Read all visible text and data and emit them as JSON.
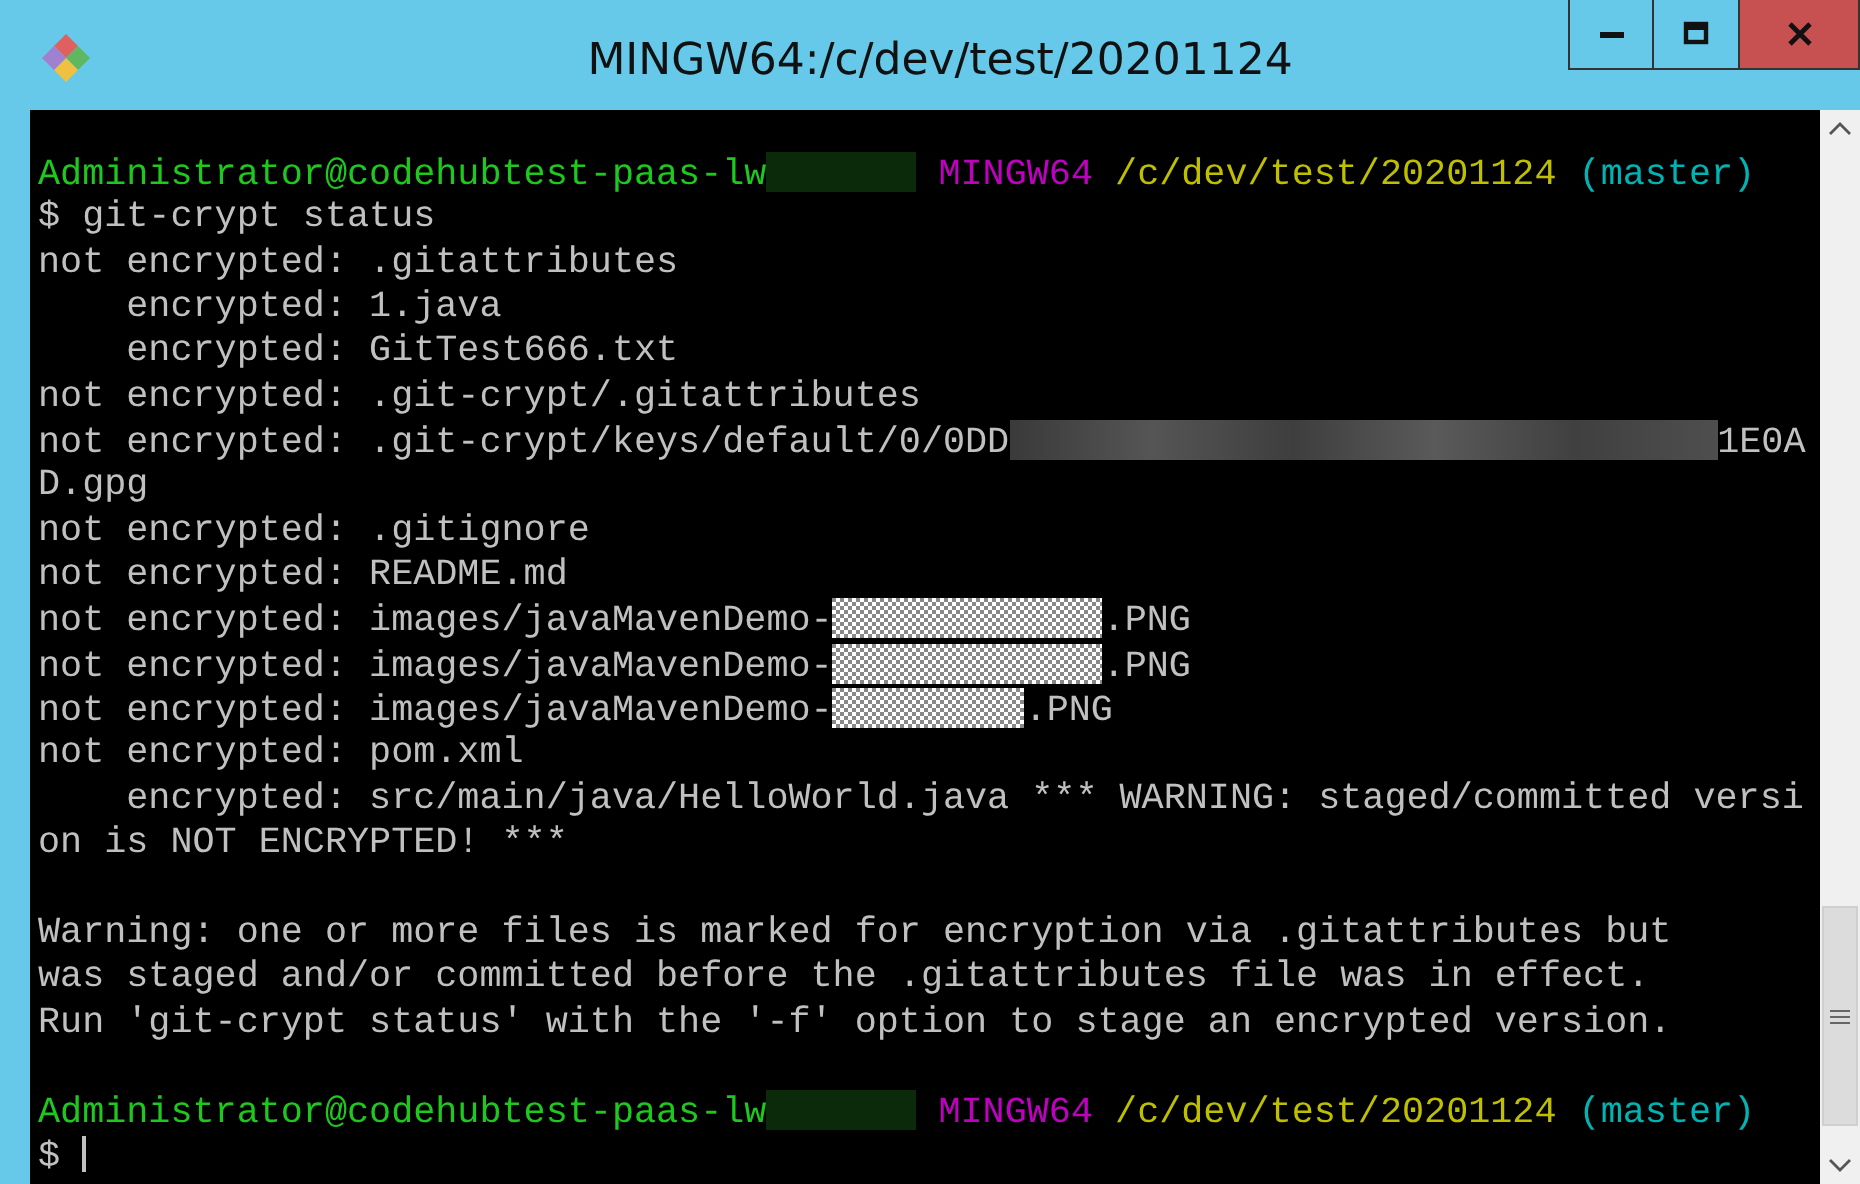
{
  "window": {
    "title": "MINGW64:/c/dev/test/20201124",
    "controls": [
      {
        "kind": "minimize"
      },
      {
        "kind": "maximize"
      },
      {
        "kind": "close"
      }
    ]
  },
  "terminal": {
    "lines": [
      {
        "kind": "text",
        "segments": [
          {
            "kind": "user",
            "text": "Administrator@codehubtest-paas-lw"
          },
          {
            "kind": "mask-dark"
          },
          {
            "kind": "system",
            "text": "MINGW64"
          },
          {
            "kind": "path",
            "text": "/c/dev/test/20201124"
          },
          {
            "kind": "branch",
            "text": "(master)"
          }
        ]
      },
      {
        "kind": "text",
        "segments": [
          {
            "kind": "plain",
            "text": "$ git-crypt status"
          }
        ]
      },
      {
        "kind": "text",
        "segments": [
          {
            "kind": "plain",
            "text": "not encrypted: .gitattributes"
          }
        ]
      },
      {
        "kind": "text",
        "segments": [
          {
            "kind": "plain",
            "text": "    encrypted: 1.java"
          }
        ]
      },
      {
        "kind": "text",
        "segments": [
          {
            "kind": "plain",
            "text": "    encrypted: GitTest666.txt"
          }
        ]
      },
      {
        "kind": "text",
        "segments": [
          {
            "kind": "plain",
            "text": "not encrypted: .git-crypt/.gitattributes"
          }
        ]
      },
      {
        "kind": "text",
        "segments": [
          {
            "kind": "plain",
            "text": "not encrypted: .git-crypt/keys/default/0/0DD"
          },
          {
            "kind": "mask-blur"
          },
          {
            "kind": "plain",
            "text": "1E0A"
          }
        ]
      },
      {
        "kind": "text",
        "segments": [
          {
            "kind": "plain",
            "text": "D.gpg"
          }
        ]
      },
      {
        "kind": "text",
        "segments": [
          {
            "kind": "plain",
            "text": "not encrypted: .gitignore"
          }
        ]
      },
      {
        "kind": "text",
        "segments": [
          {
            "kind": "plain",
            "text": "not encrypted: README.md"
          }
        ]
      },
      {
        "kind": "text",
        "segments": [
          {
            "kind": "plain",
            "text": "not encrypted: images/javaMavenDemo-"
          },
          {
            "kind": "mask-noise"
          },
          {
            "kind": "plain",
            "text": ".PNG"
          }
        ]
      },
      {
        "kind": "text",
        "segments": [
          {
            "kind": "plain",
            "text": "not encrypted: images/javaMavenDemo-"
          },
          {
            "kind": "mask-noise"
          },
          {
            "kind": "plain",
            "text": ".PNG"
          }
        ]
      },
      {
        "kind": "text",
        "segments": [
          {
            "kind": "plain",
            "text": "not encrypted: images/javaMavenDemo-"
          },
          {
            "kind": "mask-noise-short"
          },
          {
            "kind": "plain",
            "text": ".PNG"
          }
        ]
      },
      {
        "kind": "text",
        "segments": [
          {
            "kind": "plain",
            "text": "not encrypted: pom.xml"
          }
        ]
      },
      {
        "kind": "text",
        "segments": [
          {
            "kind": "plain",
            "text": "    encrypted: src/main/java/HelloWorld.java *** WARNING: staged/committed versi"
          }
        ]
      },
      {
        "kind": "text",
        "segments": [
          {
            "kind": "plain",
            "text": "on is NOT ENCRYPTED! ***"
          }
        ]
      },
      {
        "kind": "blank"
      },
      {
        "kind": "text",
        "segments": [
          {
            "kind": "plain",
            "text": "Warning: one or more files is marked for encryption via .gitattributes but"
          }
        ]
      },
      {
        "kind": "text",
        "segments": [
          {
            "kind": "plain",
            "text": "was staged and/or committed before the .gitattributes file was in effect."
          }
        ]
      },
      {
        "kind": "text",
        "segments": [
          {
            "kind": "plain",
            "text": "Run 'git-crypt status' with the '-f' option to stage an encrypted version."
          }
        ]
      },
      {
        "kind": "blank"
      },
      {
        "kind": "text",
        "segments": [
          {
            "kind": "user",
            "text": "Administrator@codehubtest-paas-lw"
          },
          {
            "kind": "mask-dark"
          },
          {
            "kind": "system",
            "text": "MINGW64"
          },
          {
            "kind": "path",
            "text": "/c/dev/test/20201124"
          },
          {
            "kind": "branch",
            "text": "(master)"
          }
        ]
      },
      {
        "kind": "text",
        "segments": [
          {
            "kind": "plain",
            "text": "$ "
          },
          {
            "kind": "cursor"
          }
        ]
      }
    ]
  }
}
